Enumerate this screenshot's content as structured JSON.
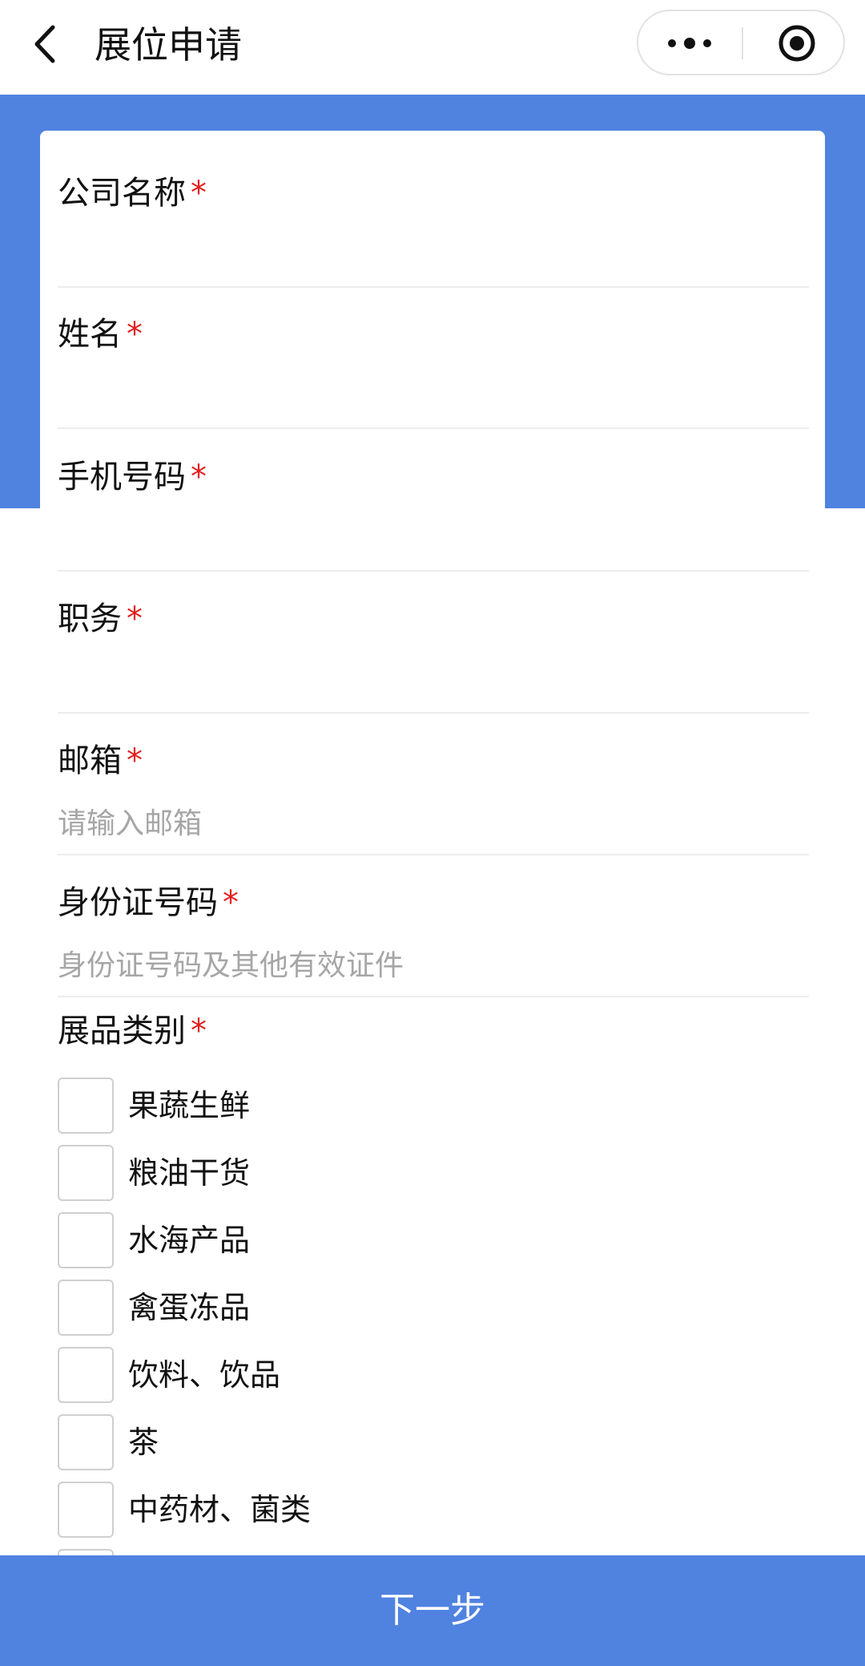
{
  "header": {
    "title": "展位申请",
    "back_icon": "chevron-left-icon",
    "more_icon": "more-dots-icon",
    "close_icon": "target-icon"
  },
  "colors": {
    "accent": "#5082e0",
    "required": "#e02020",
    "placeholder": "#a6a6a6"
  },
  "form": {
    "required_mark": "*",
    "fields": [
      {
        "label": "公司名称",
        "placeholder": ""
      },
      {
        "label": "姓名",
        "placeholder": ""
      },
      {
        "label": "手机号码",
        "placeholder": ""
      },
      {
        "label": "职务",
        "placeholder": ""
      },
      {
        "label": "邮箱",
        "placeholder": "请输入邮箱"
      },
      {
        "label": "身份证号码",
        "placeholder": "身份证号码及其他有效证件"
      }
    ],
    "category": {
      "label": "展品类别",
      "options": [
        {
          "label": "果蔬生鲜",
          "checked": false
        },
        {
          "label": "粮油干货",
          "checked": false
        },
        {
          "label": "水海产品",
          "checked": false
        },
        {
          "label": "禽蛋冻品",
          "checked": false
        },
        {
          "label": "饮料、饮品",
          "checked": false
        },
        {
          "label": "茶",
          "checked": false
        },
        {
          "label": "中药材、菌类",
          "checked": false
        }
      ]
    }
  },
  "footer": {
    "next_label": "下一步"
  }
}
